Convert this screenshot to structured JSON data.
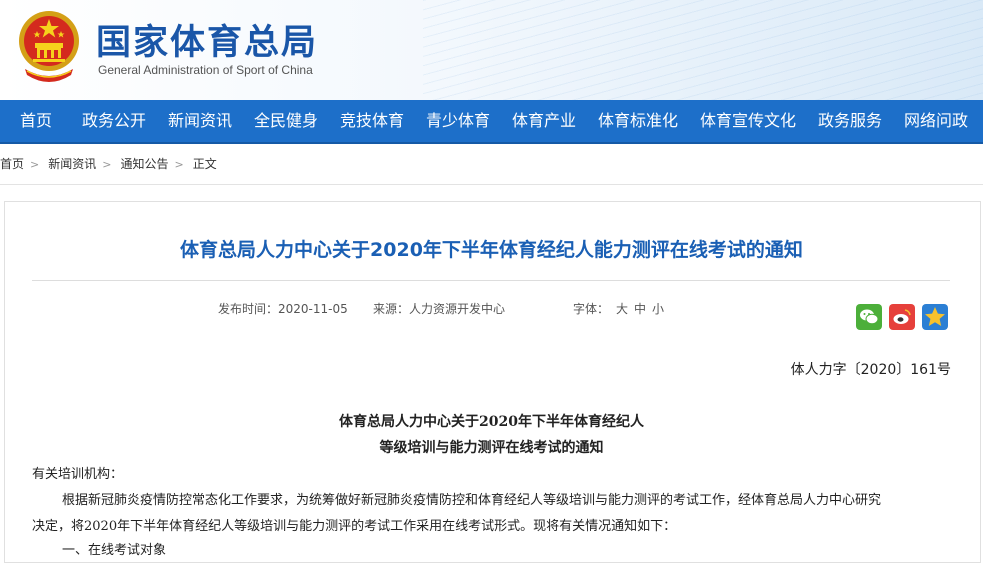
{
  "header": {
    "title": "国家体育总局",
    "subtitle": "General Administration of Sport of China"
  },
  "nav": {
    "items": [
      "首页",
      "政务公开",
      "新闻资讯",
      "全民健身",
      "竞技体育",
      "青少体育",
      "体育产业",
      "体育标准化",
      "体育宣传文化",
      "政务服务",
      "网络问政"
    ]
  },
  "breadcrumb": {
    "items": [
      "首页",
      "新闻资讯",
      "通知公告",
      "正文"
    ]
  },
  "article": {
    "title": "体育总局人力中心关于2020年下半年体育经纪人能力测评在线考试的通知",
    "publish_time": "发布时间：2020-11-05",
    "source": "来源：人力资源开发中心",
    "font_label": "字体：",
    "font_sizes": [
      "大",
      "中",
      "小"
    ],
    "doc_number": "体人力字〔2020〕161号",
    "heading_line1": "体育总局人力中心关于2020年下半年体育经纪人",
    "heading_line2": "等级培训与能力测评在线考试的通知",
    "salutation": "有关培训机构：",
    "para1_line1": "根据新冠肺炎疫情防控常态化工作要求，为统筹做好新冠肺炎疫情防控和体育经纪人等级培训与能力测评的考试工作，经体育总局人力中心研究",
    "para1_line2": "决定，将2020年下半年体育经纪人等级培训与能力测评的考试工作采用在线考试形式。现将有关情况通知如下：",
    "partial_line": "一、在线考试对象"
  },
  "share": {
    "icons": [
      "wechat-icon",
      "weibo-icon",
      "qzone-icon"
    ],
    "colors": {
      "wechat": "#4caf3a",
      "weibo": "#e6403b",
      "qzone": "#2b7fd4"
    }
  },
  "theme": {
    "nav_bg": "#1d6fc9",
    "title_color": "#1a5fb4"
  }
}
